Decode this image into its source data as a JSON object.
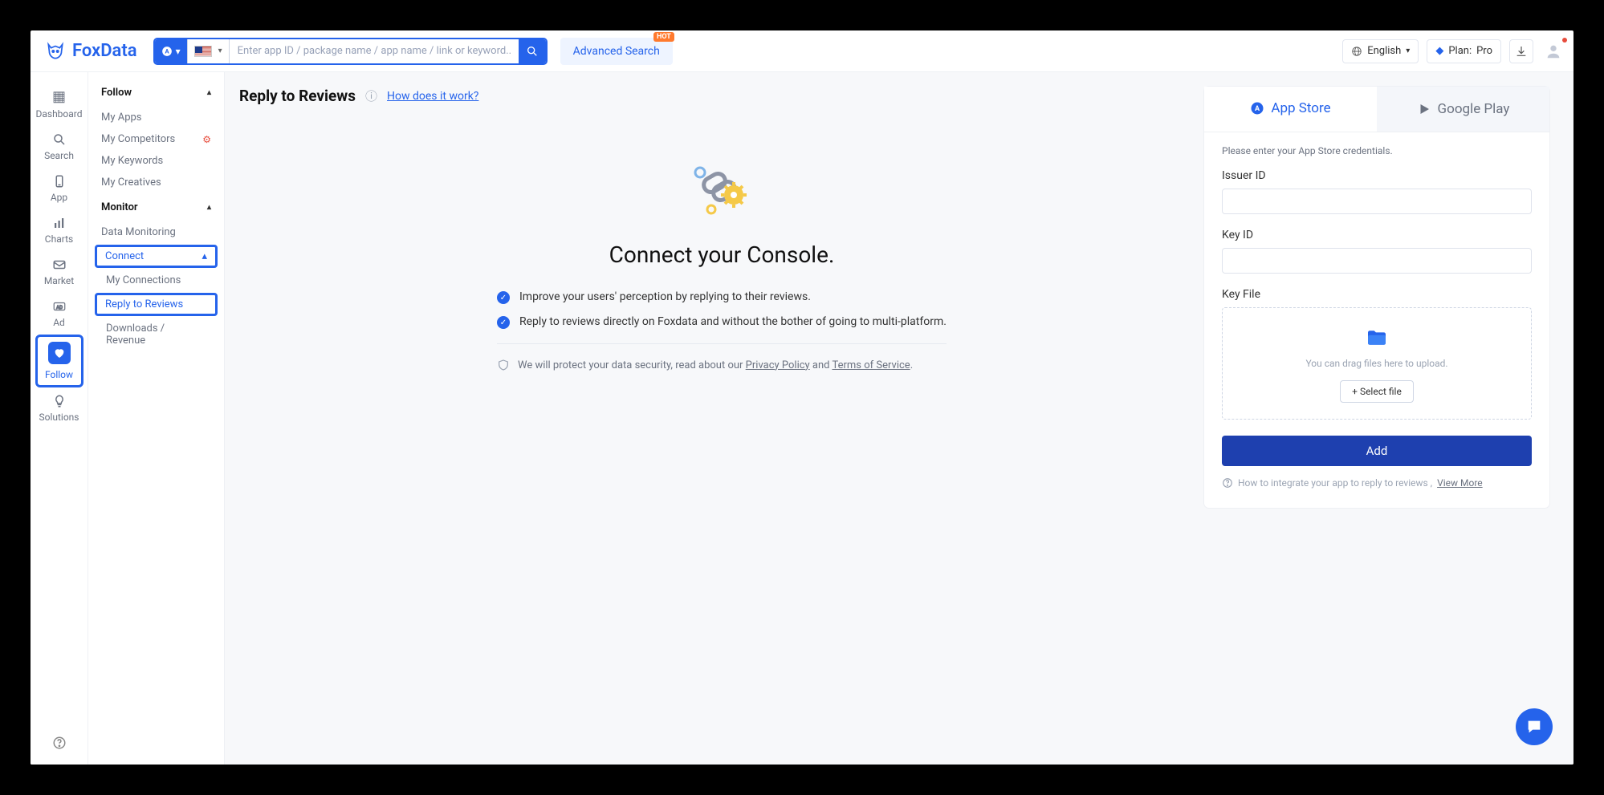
{
  "brand": {
    "name": "FoxData"
  },
  "search": {
    "placeholder": "Enter app ID / package name / app name / link or keyword...",
    "advanced_label": "Advanced Search",
    "hot_badge": "HOT"
  },
  "topbar": {
    "language": "English",
    "plan_prefix": "Plan:",
    "plan_value": "Pro"
  },
  "rail": {
    "dashboard": "Dashboard",
    "search": "Search",
    "app": "App",
    "charts": "Charts",
    "market": "Market",
    "ad": "Ad",
    "follow": "Follow",
    "solutions": "Solutions"
  },
  "sidebar": {
    "follow": "Follow",
    "my_apps": "My Apps",
    "my_competitors": "My Competitors",
    "my_keywords": "My Keywords",
    "my_creatives": "My Creatives",
    "monitor": "Monitor",
    "data_monitoring": "Data Monitoring",
    "connect": "Connect",
    "my_connections": "My Connections",
    "reply_reviews": "Reply to Reviews",
    "downloads_rev": "Downloads / Revenue"
  },
  "page": {
    "title": "Reply to Reviews",
    "how_link": "How does it work?"
  },
  "center": {
    "heading": "Connect your Console.",
    "bullet1": "Improve your users' perception by replying to their reviews.",
    "bullet2": "Reply to reviews directly on Foxdata and without the bother of going to multi-platform.",
    "protect_prefix": "We will protect your data security, read about our ",
    "privacy": "Privacy Policy",
    "and": " and ",
    "tos": "Terms of Service",
    "period": "."
  },
  "panel": {
    "tab_appstore": "App Store",
    "tab_google": "Google Play",
    "cred_hint": "Please enter your App Store credentials.",
    "issuer_label": "Issuer ID",
    "keyid_label": "Key ID",
    "keyfile_label": "Key File",
    "dropzone_text": "You can drag files here to upload.",
    "select_file": "+ Select file",
    "add_btn": "Add",
    "integrate_prefix": "How to integrate your app to reply to reviews ,",
    "view_more": "View More"
  }
}
